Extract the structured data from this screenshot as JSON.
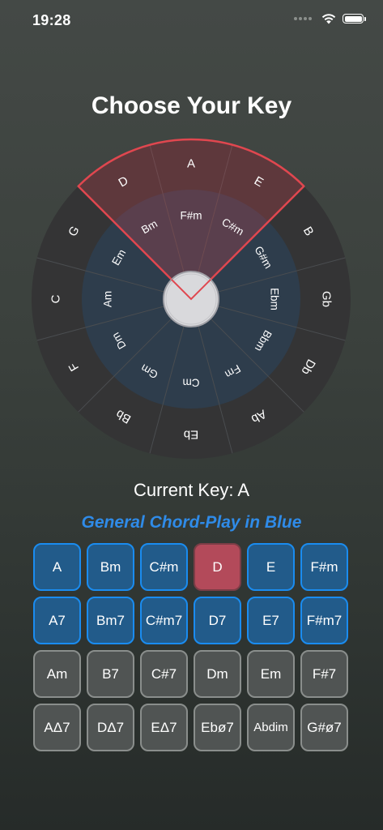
{
  "status_bar": {
    "time": "19:28"
  },
  "title": "Choose Your Key",
  "current_key": "Current Key: A",
  "subtitle": "General Chord-Play in Blue",
  "colors": {
    "blue_border": "#1a8cf0",
    "blue_fill": "#225b8a",
    "red_fill": "#b34a5a",
    "gray_fill": "#505453",
    "highlight_outline": "#e0474f",
    "subtitle": "#2f8be8"
  },
  "wheel": {
    "outer_keys": [
      "A",
      "E",
      "B",
      "Gb",
      "Db",
      "Ab",
      "Eb",
      "Bb",
      "F",
      "C",
      "G",
      "D"
    ],
    "inner_keys": [
      "F#m",
      "C#m",
      "G#m",
      "Ebm",
      "Bbm",
      "Fm",
      "Cm",
      "Gm",
      "Dm",
      "Am",
      "Em",
      "Bm"
    ],
    "highlighted": [
      "D",
      "A",
      "E"
    ],
    "selected": "A"
  },
  "chords": [
    {
      "label": "A",
      "style": "blue"
    },
    {
      "label": "Bm",
      "style": "blue"
    },
    {
      "label": "C#m",
      "style": "blue"
    },
    {
      "label": "D",
      "style": "red"
    },
    {
      "label": "E",
      "style": "blue"
    },
    {
      "label": "F#m",
      "style": "blue"
    },
    {
      "label": "A7",
      "style": "blue"
    },
    {
      "label": "Bm7",
      "style": "blue"
    },
    {
      "label": "C#m7",
      "style": "blue"
    },
    {
      "label": "D7",
      "style": "blue"
    },
    {
      "label": "E7",
      "style": "blue"
    },
    {
      "label": "F#m7",
      "style": "blue"
    },
    {
      "label": "Am",
      "style": "gray"
    },
    {
      "label": "B7",
      "style": "gray"
    },
    {
      "label": "C#7",
      "style": "gray"
    },
    {
      "label": "Dm",
      "style": "gray"
    },
    {
      "label": "Em",
      "style": "gray"
    },
    {
      "label": "F#7",
      "style": "gray"
    },
    {
      "label": "AΔ7",
      "style": "gray"
    },
    {
      "label": "DΔ7",
      "style": "gray"
    },
    {
      "label": "EΔ7",
      "style": "gray"
    },
    {
      "label": "Ebø7",
      "style": "gray"
    },
    {
      "label": "Abdim",
      "style": "gray"
    },
    {
      "label": "G#ø7",
      "style": "gray"
    }
  ]
}
